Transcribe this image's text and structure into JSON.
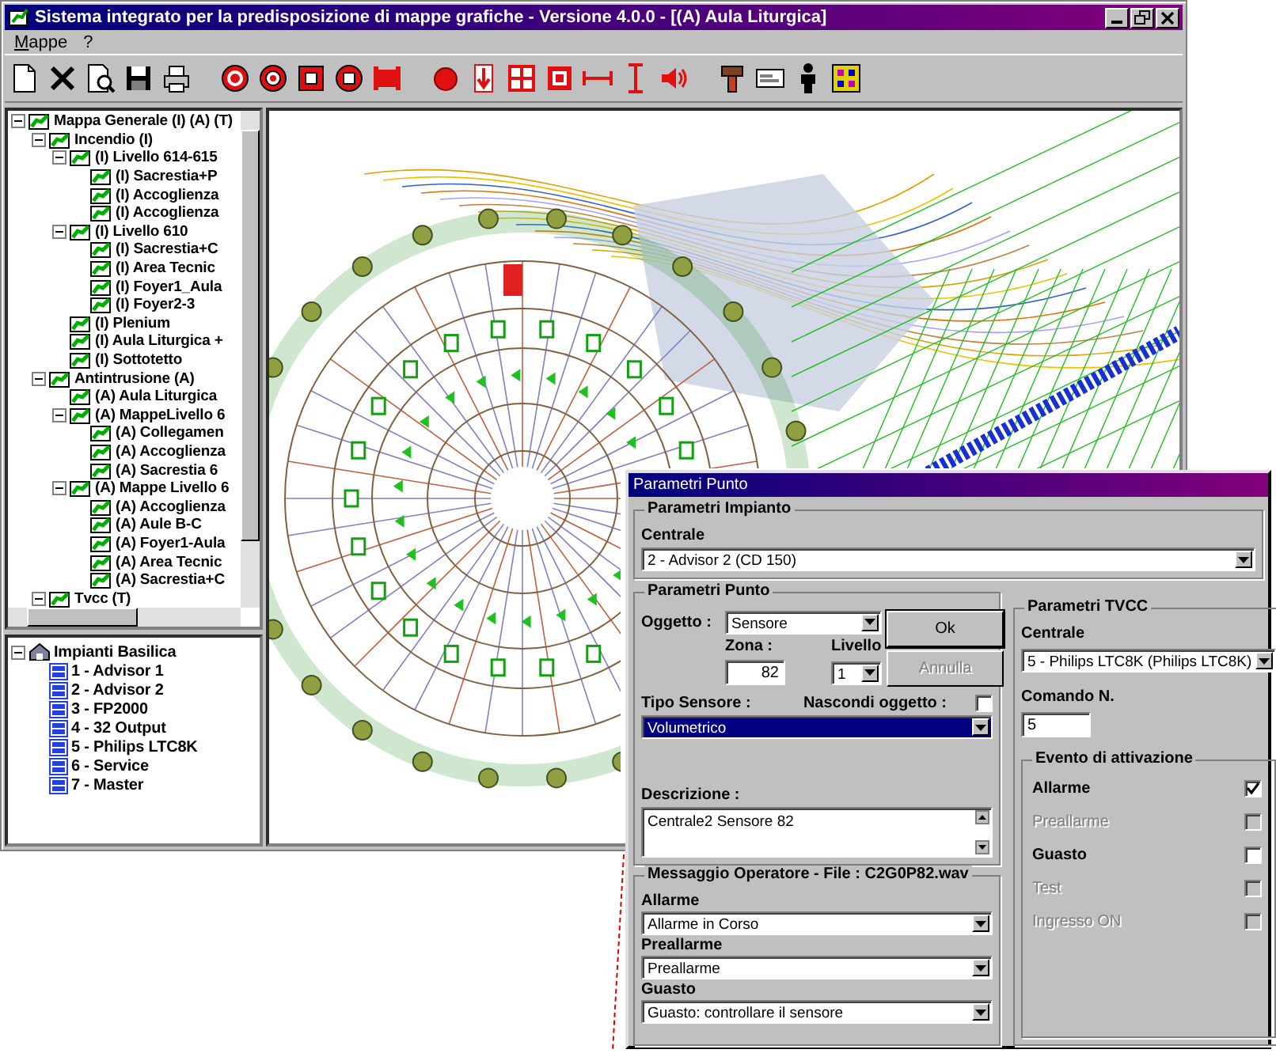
{
  "window": {
    "title": "Sistema integrato per la predisposizione di mappe grafiche - Versione 4.0.0 - [(A) Aula Liturgica]"
  },
  "menu": [
    {
      "label": "Mappe"
    },
    {
      "label": "?"
    }
  ],
  "map_tree": [
    {
      "label": "Mappa Generale (I) (A) (T)",
      "expanded": true,
      "children": [
        {
          "label": "Incendio (I)",
          "expanded": true,
          "children": [
            {
              "label": "(I) Livello 614-615",
              "expanded": true,
              "children": [
                {
                  "label": "(I) Sacrestia+P"
                },
                {
                  "label": "(I) Accoglienza"
                },
                {
                  "label": "(I) Accoglienza"
                }
              ]
            },
            {
              "label": "(I) Livello 610",
              "expanded": true,
              "children": [
                {
                  "label": "(I) Sacrestia+C"
                },
                {
                  "label": "(I) Area Tecnic"
                },
                {
                  "label": "(I) Foyer1_Aula"
                },
                {
                  "label": "(I) Foyer2-3"
                }
              ]
            },
            {
              "label": "(I) Plenium"
            },
            {
              "label": "(I) Aula Liturgica +"
            },
            {
              "label": "(I) Sottotetto"
            }
          ]
        },
        {
          "label": "Antintrusione (A)",
          "expanded": true,
          "children": [
            {
              "label": "(A) Aula Liturgica"
            },
            {
              "label": "(A) MappeLivello 6",
              "expanded": true,
              "children": [
                {
                  "label": "(A) Collegamen"
                },
                {
                  "label": "(A) Accoglienza"
                },
                {
                  "label": "(A) Sacrestia 6"
                }
              ]
            },
            {
              "label": "(A) Mappe Livello 6",
              "expanded": true,
              "children": [
                {
                  "label": "(A) Accoglienza"
                },
                {
                  "label": "(A) Aule B-C"
                },
                {
                  "label": "(A) Foyer1-Aula"
                },
                {
                  "label": "(A) Area Tecnic"
                },
                {
                  "label": "(A) Sacrestia+C"
                }
              ]
            }
          ]
        },
        {
          "label": "Tvcc (T)",
          "expanded": true
        }
      ]
    }
  ],
  "plant_tree": [
    {
      "label": "Impianti Basilica",
      "expanded": true,
      "children": [
        {
          "label": "1 - Advisor 1"
        },
        {
          "label": "2 - Advisor 2"
        },
        {
          "label": "3 - FP2000"
        },
        {
          "label": "4 - 32 Output"
        },
        {
          "label": "5 - Philips LTC8K"
        },
        {
          "label": "6 - Service"
        },
        {
          "label": "7 - Master"
        }
      ]
    }
  ],
  "dialog": {
    "title": "Parametri Punto",
    "impianto": {
      "title": "Parametri Impianto",
      "centrale_label": "Centrale",
      "centrale": "2 - Advisor 2 (CD 150)"
    },
    "punto": {
      "title": "Parametri Punto",
      "oggetto_label": "Oggetto :",
      "oggetto": "Sensore",
      "zona_label": "Zona :",
      "zona": "82",
      "livello_label": "Livello",
      "livello": "1",
      "tipo_label": "Tipo Sensore :",
      "tipo": "Volumetrico",
      "tipo_focused": true,
      "nascondi": {
        "label": "Nascondi oggetto :",
        "checked": false
      },
      "descrizione_label": "Descrizione :",
      "descrizione": "Centrale2 Sensore 82"
    },
    "buttons": [
      {
        "label": "Ok",
        "disabled": false
      },
      {
        "label": "Annulla",
        "disabled": true
      }
    ],
    "messaggio": {
      "title": "Messaggio Operatore - File : C2G0P82.wav",
      "fields": [
        {
          "label": "Allarme",
          "value": "Allarme in Corso"
        },
        {
          "label": "Preallarme",
          "value": "Preallarme"
        },
        {
          "label": "Guasto",
          "value": "Guasto: controllare il sensore"
        }
      ]
    },
    "tvcc": {
      "title": "Parametri TVCC",
      "centrale_label": "Centrale",
      "centrale": "5 - Philips LTC8K (Philips LTC8K)",
      "comando_label": "Comando N.",
      "comando": "5",
      "evento": {
        "title": "Evento di attivazione",
        "options": [
          {
            "label": "Allarme",
            "checked": true,
            "disabled": false
          },
          {
            "label": "Preallarme",
            "checked": false,
            "disabled": true
          },
          {
            "label": "Guasto",
            "checked": false,
            "disabled": false
          },
          {
            "label": "Test",
            "checked": false,
            "disabled": true
          },
          {
            "label": "Ingresso ON",
            "checked": false,
            "disabled": true
          }
        ]
      }
    }
  }
}
